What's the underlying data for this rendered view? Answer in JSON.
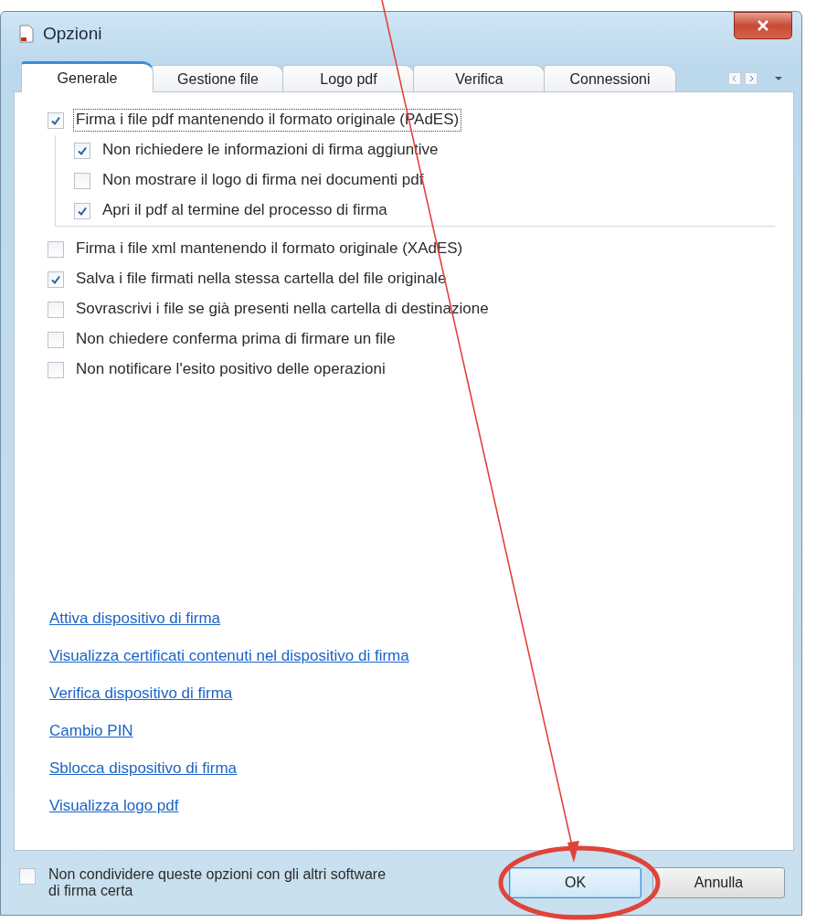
{
  "window": {
    "title": "Opzioni"
  },
  "tabs": [
    {
      "label": "Generale",
      "selected": true
    },
    {
      "label": "Gestione file",
      "selected": false
    },
    {
      "label": "Logo pdf",
      "selected": false
    },
    {
      "label": "Verifica",
      "selected": false
    },
    {
      "label": "Connessioni",
      "selected": false
    }
  ],
  "options": [
    {
      "label": "Firma i file pdf mantenendo il formato originale (PAdES)",
      "checked": true,
      "focused": true,
      "children": [
        {
          "label": "Non richiedere le informazioni di firma aggiuntive",
          "checked": true
        },
        {
          "label": "Non mostrare il logo di firma nei documenti pdf",
          "checked": false
        },
        {
          "label": "Apri il pdf al termine del processo di firma",
          "checked": true
        }
      ]
    },
    {
      "label": "Firma i file xml mantenendo il formato originale (XAdES)",
      "checked": false
    },
    {
      "label": "Salva i file firmati nella stessa cartella del file originale",
      "checked": true
    },
    {
      "label": "Sovrascrivi i file se già presenti nella cartella di destinazione",
      "checked": false
    },
    {
      "label": "Non chiedere conferma prima di firmare un file",
      "checked": false
    },
    {
      "label": "Non notificare l'esito positivo delle operazioni",
      "checked": false
    }
  ],
  "links": [
    "Attiva dispositivo di firma",
    "Visualizza certificati contenuti nel dispositivo di firma",
    "Verifica dispositivo di firma",
    "Cambio PIN",
    "Sblocca dispositivo di firma",
    "Visualizza logo pdf"
  ],
  "footer": {
    "share_option": {
      "label": "Non condividere queste opzioni con gli altri software di firma certa",
      "checked": false
    },
    "buttons": [
      {
        "label": "OK",
        "kind": "default"
      },
      {
        "label": "Annulla",
        "kind": "normal"
      }
    ]
  },
  "annotation": {
    "arrow": true,
    "circle": true
  }
}
